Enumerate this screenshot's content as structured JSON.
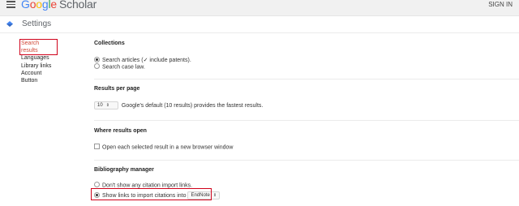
{
  "header": {
    "logo_google": "Google",
    "logo_scholar": "Scholar",
    "signin_label": "SIGN IN"
  },
  "settings_bar": {
    "title": "Settings"
  },
  "sidebar": {
    "items": [
      {
        "label": "Search results",
        "active": true
      },
      {
        "label": "Languages"
      },
      {
        "label": "Library links"
      },
      {
        "label": "Account"
      },
      {
        "label": "Button"
      }
    ]
  },
  "collections": {
    "title": "Collections",
    "search_articles_prefix": "Search articles (",
    "include_patents": "include patents).",
    "search_case_law": "Search case law."
  },
  "results_per_page": {
    "title": "Results per page",
    "selected_value": "10",
    "description": "Google's default (10 results) provides the fastest results."
  },
  "where_results_open": {
    "title": "Where results open",
    "new_window_label": "Open each selected result in a new browser window"
  },
  "bibliography": {
    "title": "Bibliography manager",
    "dont_show_label": "Don't show any citation import links.",
    "show_links_label": "Show links to import citations into",
    "manager_value": "EndNote"
  }
}
